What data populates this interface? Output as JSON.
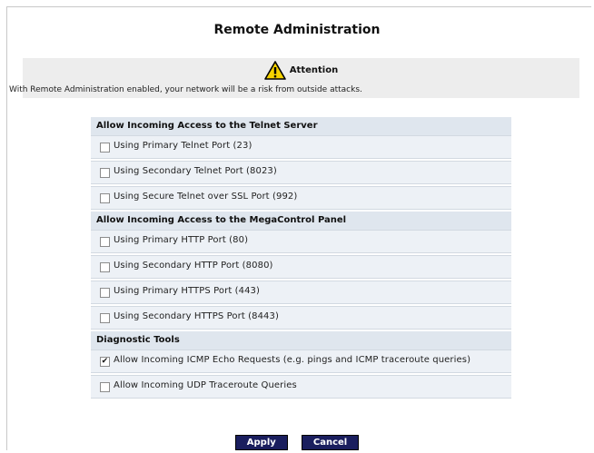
{
  "page_title": "Remote Administration",
  "attention": {
    "heading": "Attention",
    "message": "With Remote Administration enabled, your network will be a risk from outside attacks."
  },
  "sections": [
    {
      "title": "Allow Incoming Access to the Telnet Server",
      "options": [
        {
          "label": "Using Primary Telnet Port (23)",
          "checked": false
        },
        {
          "label": "Using Secondary Telnet Port (8023)",
          "checked": false
        },
        {
          "label": "Using Secure Telnet over SSL Port (992)",
          "checked": false
        }
      ]
    },
    {
      "title": "Allow Incoming Access to the MegaControl Panel",
      "options": [
        {
          "label": "Using Primary HTTP Port (80)",
          "checked": false
        },
        {
          "label": "Using Secondary HTTP Port (8080)",
          "checked": false
        },
        {
          "label": "Using Primary HTTPS Port (443)",
          "checked": false
        },
        {
          "label": "Using Secondary HTTPS Port (8443)",
          "checked": false
        }
      ]
    },
    {
      "title": "Diagnostic Tools",
      "options": [
        {
          "label": "Allow Incoming ICMP Echo Requests (e.g. pings and ICMP traceroute queries)",
          "checked": true
        },
        {
          "label": "Allow Incoming UDP Traceroute Queries",
          "checked": false
        }
      ]
    }
  ],
  "buttons": {
    "apply": "Apply",
    "cancel": "Cancel"
  },
  "checkmark": "✔"
}
